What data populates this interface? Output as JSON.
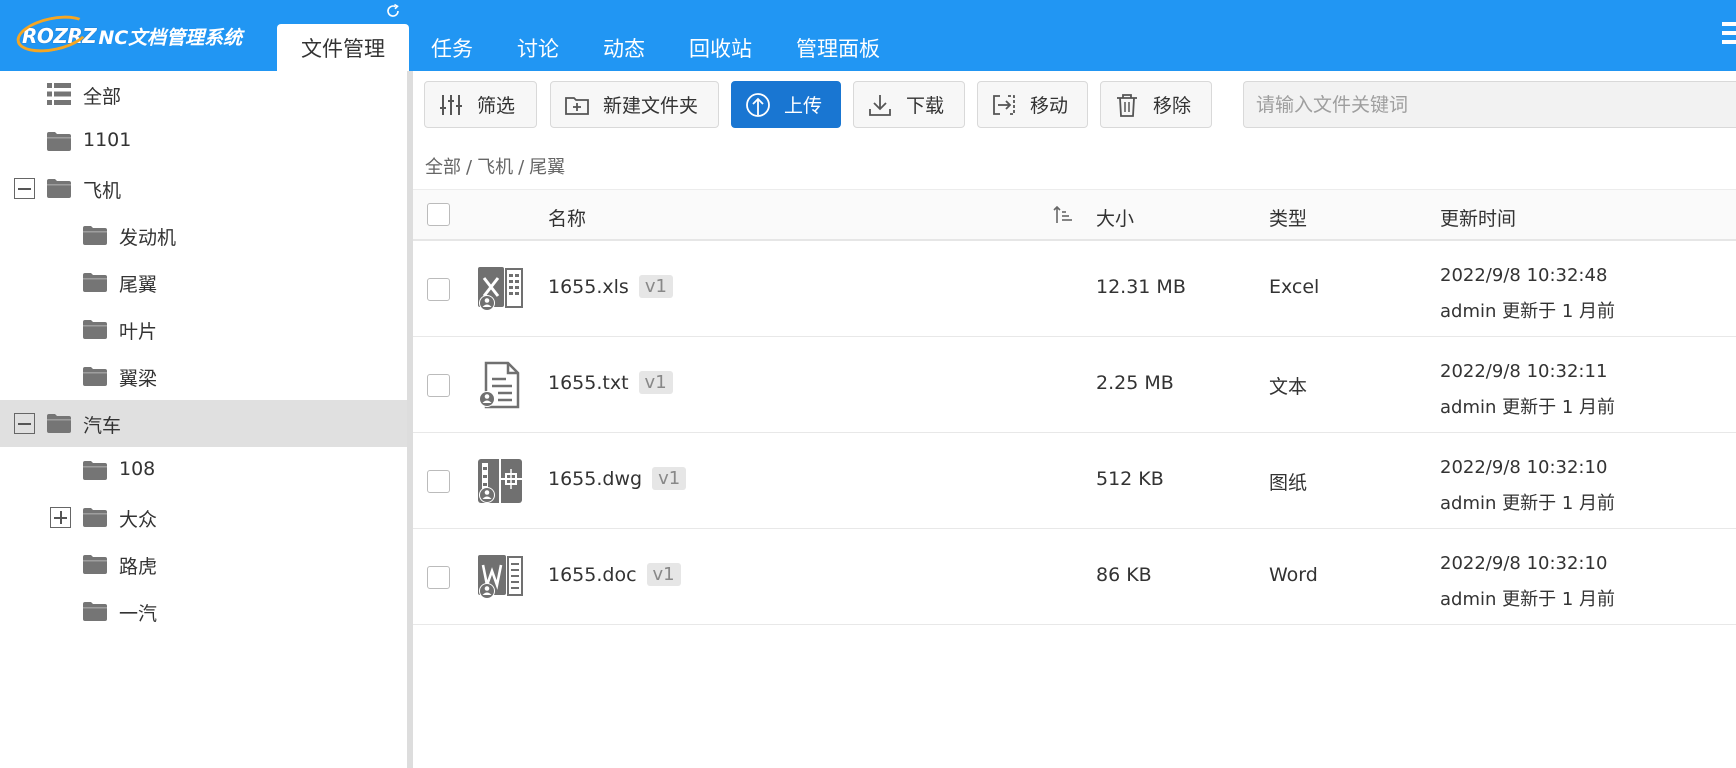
{
  "app": {
    "logo_mark": "ROZRZ",
    "logo_text": "NC文档管理系统"
  },
  "tabs": [
    {
      "label": "文件管理",
      "active": true
    },
    {
      "label": "任务"
    },
    {
      "label": "讨论"
    },
    {
      "label": "动态"
    },
    {
      "label": "回收站"
    },
    {
      "label": "管理面板"
    }
  ],
  "tree": [
    {
      "label": "全部",
      "icon": "list-icon"
    },
    {
      "label": "1101",
      "icon": "folder-icon"
    },
    {
      "label": "飞机",
      "icon": "folder-icon",
      "toggle": "collapse"
    },
    {
      "label": "发动机",
      "icon": "folder-icon"
    },
    {
      "label": "尾翼",
      "icon": "folder-icon"
    },
    {
      "label": "叶片",
      "icon": "folder-icon"
    },
    {
      "label": "翼梁",
      "icon": "folder-icon"
    },
    {
      "label": "汽车",
      "icon": "folder-icon",
      "toggle": "collapse",
      "selected": true
    },
    {
      "label": "108",
      "icon": "folder-icon"
    },
    {
      "label": "大众",
      "icon": "folder-icon",
      "toggle": "expand"
    },
    {
      "label": "路虎",
      "icon": "folder-icon"
    },
    {
      "label": "一汽",
      "icon": "folder-icon"
    }
  ],
  "toolbar": {
    "filter": "筛选",
    "new_folder": "新建文件夹",
    "upload": "上传",
    "download": "下载",
    "move": "移动",
    "remove": "移除",
    "search_placeholder": "请输入文件关键词"
  },
  "breadcrumb": [
    "全部",
    "飞机",
    "尾翼"
  ],
  "table": {
    "headers": {
      "name": "名称",
      "size": "大小",
      "type": "类型",
      "updated": "更新时间"
    },
    "rows": [
      {
        "name": "1655.xls",
        "version": "v1",
        "size": "12.31 MB",
        "type": "Excel",
        "time": "2022/9/8 10:32:48",
        "updater": "admin 更新于 1 月前",
        "icon": "excel-file-icon"
      },
      {
        "name": "1655.txt",
        "version": "v1",
        "size": "2.25 MB",
        "type": "文本",
        "time": "2022/9/8 10:32:11",
        "updater": "admin 更新于 1 月前",
        "icon": "text-file-icon"
      },
      {
        "name": "1655.dwg",
        "version": "v1",
        "size": "512 KB",
        "type": "图纸",
        "time": "2022/9/8 10:32:10",
        "updater": "admin 更新于 1 月前",
        "icon": "drawing-file-icon"
      },
      {
        "name": "1655.doc",
        "version": "v1",
        "size": "86 KB",
        "type": "Word",
        "time": "2022/9/8 10:32:10",
        "updater": "admin 更新于 1 月前",
        "icon": "word-file-icon"
      }
    ]
  },
  "colors": {
    "header_bg": "#2196f3",
    "primary_button": "#1976d2",
    "logo_ring": "#f5a623",
    "selected_row": "#e0e0e0"
  }
}
